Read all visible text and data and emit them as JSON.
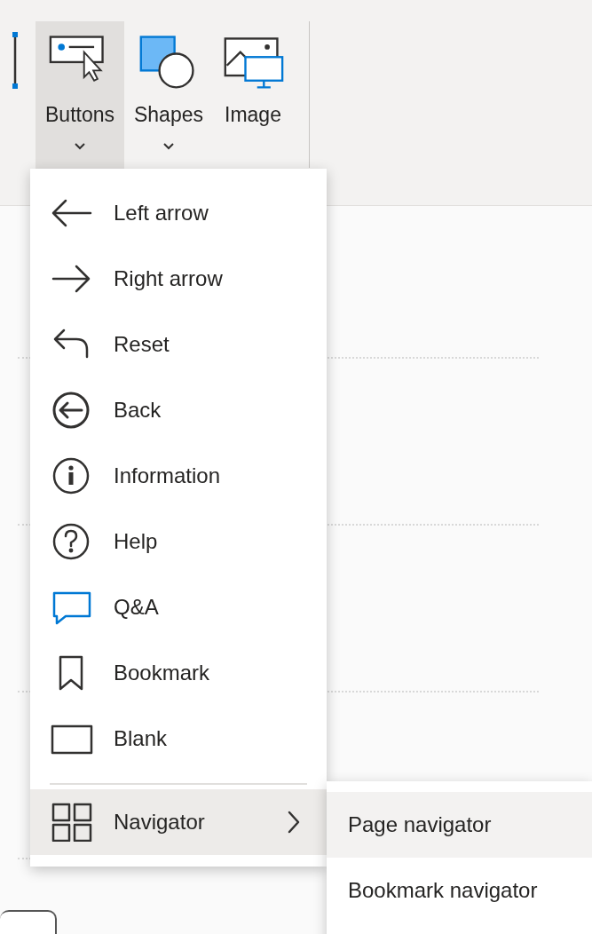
{
  "ribbon": {
    "buttons": [
      {
        "label": "Buttons",
        "selected": true,
        "has_dropdown": true
      },
      {
        "label": "Shapes",
        "selected": false,
        "has_dropdown": true
      },
      {
        "label": "Image",
        "selected": false,
        "has_dropdown": false
      }
    ]
  },
  "menu": {
    "items": [
      {
        "label": "Left arrow"
      },
      {
        "label": "Right arrow"
      },
      {
        "label": "Reset"
      },
      {
        "label": "Back"
      },
      {
        "label": "Information"
      },
      {
        "label": "Help"
      },
      {
        "label": "Q&A"
      },
      {
        "label": "Bookmark"
      },
      {
        "label": "Blank"
      }
    ],
    "navigator": {
      "label": "Navigator",
      "selected": true
    }
  },
  "submenu": {
    "items": [
      {
        "label": "Page navigator",
        "selected": true
      },
      {
        "label": "Bookmark navigator",
        "selected": false
      }
    ]
  }
}
